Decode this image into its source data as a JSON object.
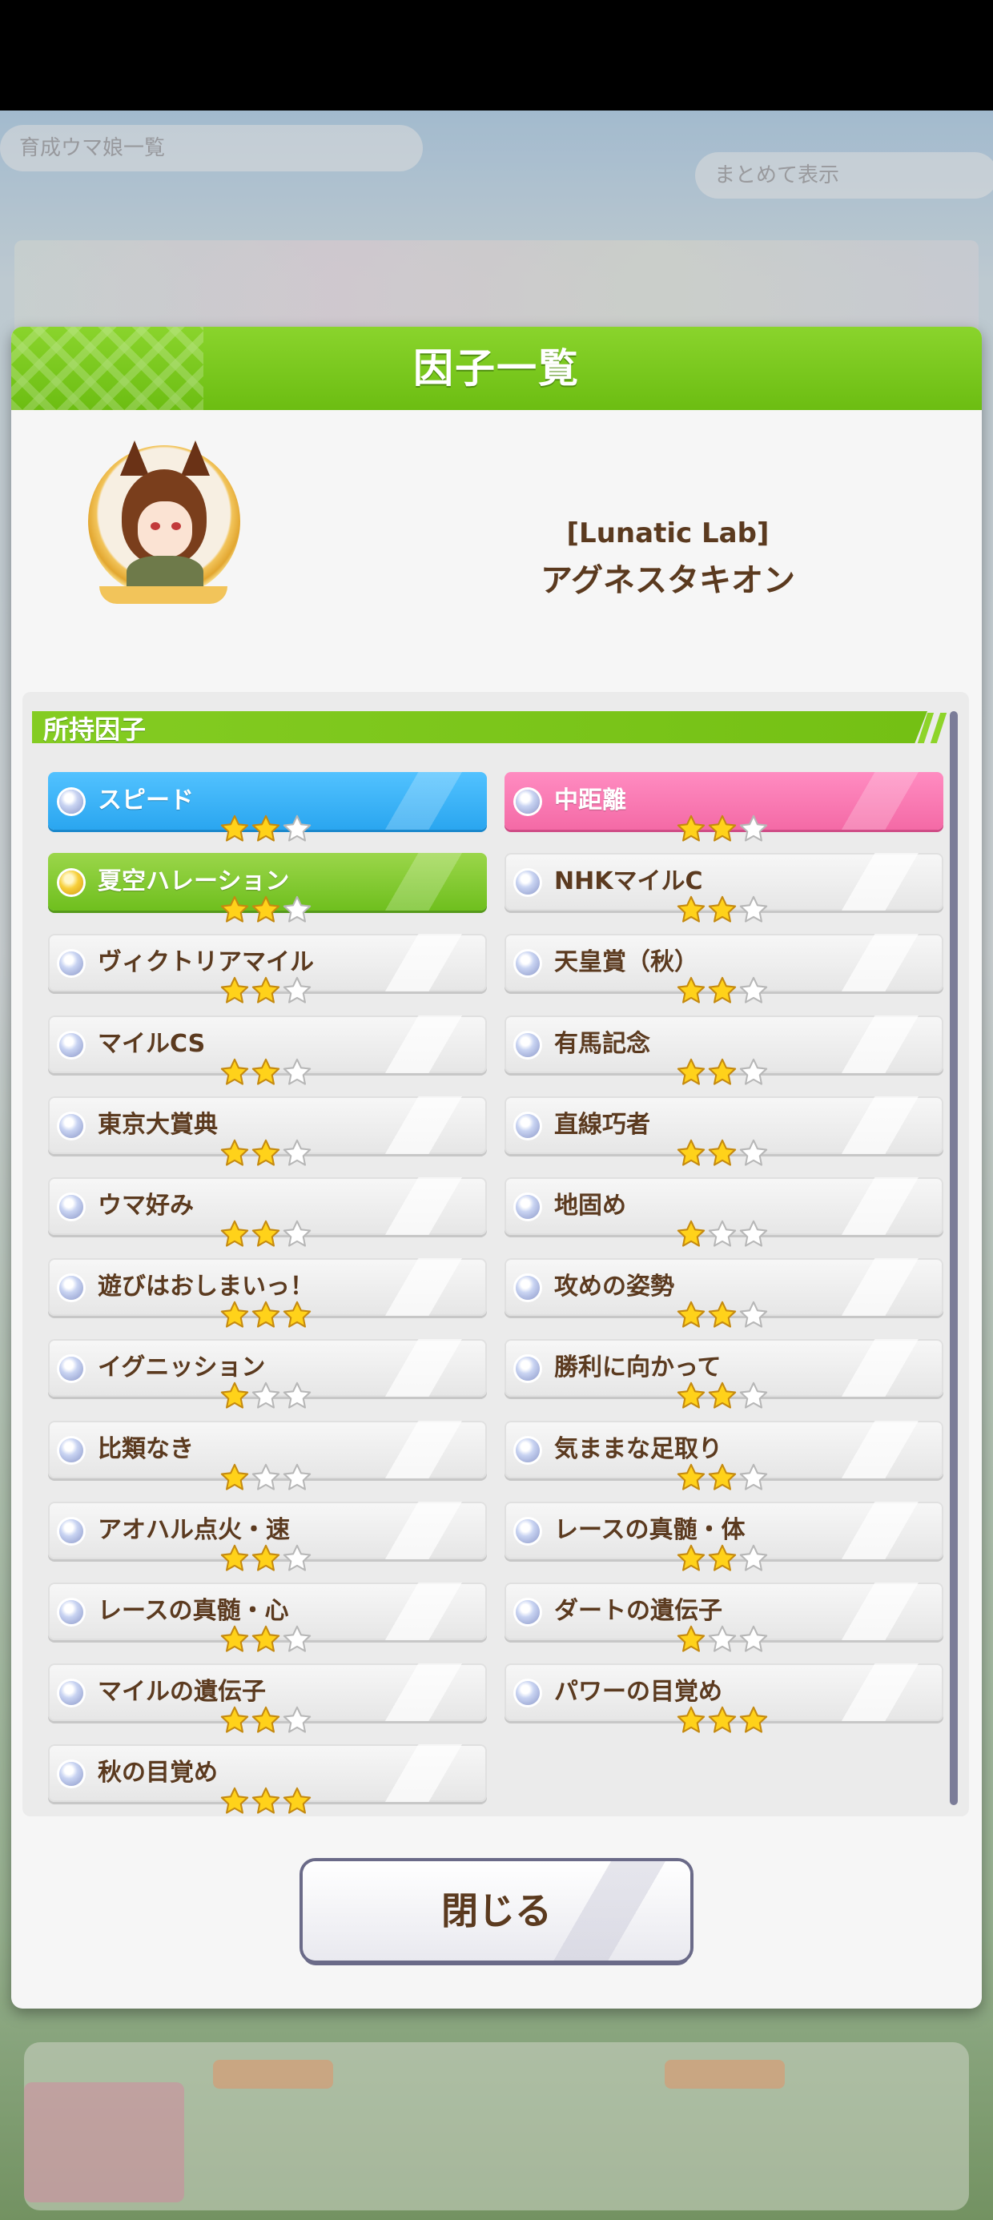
{
  "background": {
    "top_left_pill": "育成ウマ娘一覧",
    "top_right_pill": "まとめて表示"
  },
  "modal": {
    "title": "因子一覧",
    "character": {
      "epithet": "[Lunatic Lab]",
      "name": "アグネスタキオン"
    },
    "section_label": "所持因子",
    "close_label": "閉じる",
    "factors_left": [
      {
        "name": "スピード",
        "stars": 2,
        "type": "blue"
      },
      {
        "name": "夏空ハレーション",
        "stars": 2,
        "type": "green"
      },
      {
        "name": "ヴィクトリアマイル",
        "stars": 2,
        "type": "white"
      },
      {
        "name": "マイルCS",
        "stars": 2,
        "type": "white"
      },
      {
        "name": "東京大賞典",
        "stars": 2,
        "type": "white"
      },
      {
        "name": "ウマ好み",
        "stars": 2,
        "type": "white"
      },
      {
        "name": "遊びはおしまいっ！",
        "stars": 3,
        "type": "white"
      },
      {
        "name": "イグニッション",
        "stars": 1,
        "type": "white"
      },
      {
        "name": "比類なき",
        "stars": 1,
        "type": "white"
      },
      {
        "name": "アオハル点火・速",
        "stars": 2,
        "type": "white"
      },
      {
        "name": "レースの真髄・心",
        "stars": 2,
        "type": "white"
      },
      {
        "name": "マイルの遺伝子",
        "stars": 2,
        "type": "white"
      },
      {
        "name": "秋の目覚め",
        "stars": 3,
        "type": "white"
      }
    ],
    "factors_right": [
      {
        "name": "中距離",
        "stars": 2,
        "type": "pink"
      },
      {
        "name": "NHKマイルC",
        "stars": 2,
        "type": "white"
      },
      {
        "name": "天皇賞（秋）",
        "stars": 2,
        "type": "white"
      },
      {
        "name": "有馬記念",
        "stars": 2,
        "type": "white"
      },
      {
        "name": "直線巧者",
        "stars": 2,
        "type": "white"
      },
      {
        "name": "地固め",
        "stars": 1,
        "type": "white"
      },
      {
        "name": "攻めの姿勢",
        "stars": 2,
        "type": "white"
      },
      {
        "name": "勝利に向かって",
        "stars": 2,
        "type": "white"
      },
      {
        "name": "気ままな足取り",
        "stars": 2,
        "type": "white"
      },
      {
        "name": "レースの真髄・体",
        "stars": 2,
        "type": "white"
      },
      {
        "name": "ダートの遺伝子",
        "stars": 1,
        "type": "white"
      },
      {
        "name": "パワーの目覚め",
        "stars": 3,
        "type": "white"
      }
    ]
  }
}
